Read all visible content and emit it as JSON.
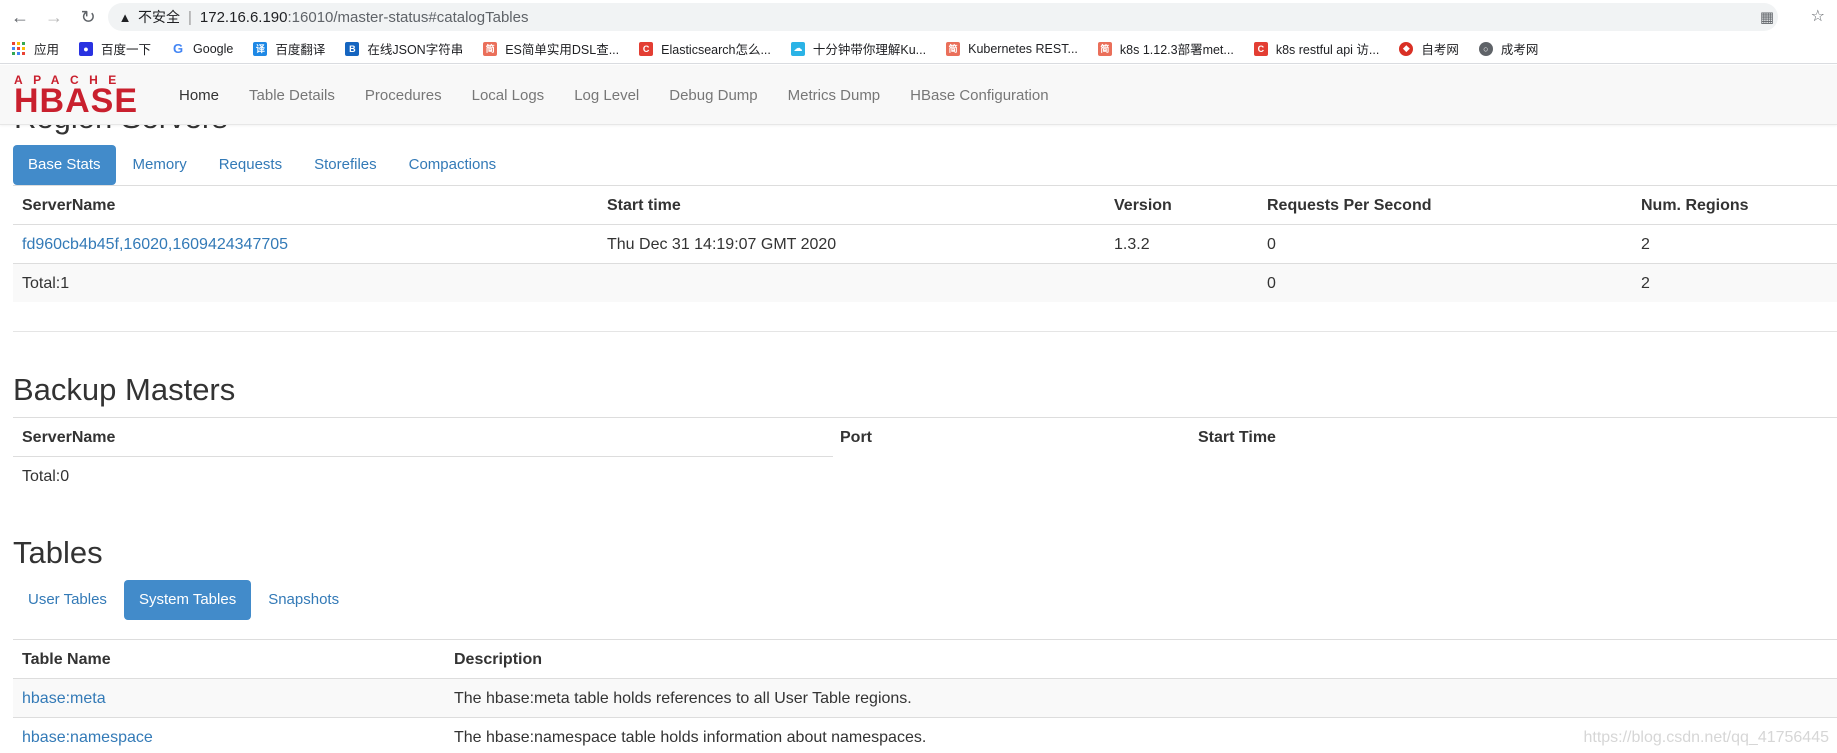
{
  "browser": {
    "insecure_label": "不安全",
    "url_host": "172.16.6.190",
    "url_rest": ":16010/master-status#catalogTables"
  },
  "bookmarks": [
    {
      "label": "应用",
      "icon": "apps-grid-icon",
      "color": "#4285f4"
    },
    {
      "label": "百度一下",
      "icon": "baidu-paw-icon",
      "color": "#2932e1"
    },
    {
      "label": "Google",
      "icon": "google-g-icon",
      "color": "#4285f4"
    },
    {
      "label": "百度翻译",
      "icon": "baidu-translate-icon",
      "color": "#1e88e5"
    },
    {
      "label": "在线JSON字符串",
      "icon": "json-icon",
      "color": "#1565c0"
    },
    {
      "label": "ES简单实用DSL查...",
      "icon": "jianshu-icon",
      "color": "#ea6f5a"
    },
    {
      "label": "Elasticsearch怎么...",
      "icon": "csdn-c-icon",
      "color": "#e33e33"
    },
    {
      "label": "十分钟带你理解Ku...",
      "icon": "cloud-icon",
      "color": "#2bb3e6"
    },
    {
      "label": "Kubernetes REST...",
      "icon": "jianshu-icon",
      "color": "#ea6f5a"
    },
    {
      "label": "k8s 1.12.3部署met...",
      "icon": "jianshu-icon",
      "color": "#ea6f5a"
    },
    {
      "label": "k8s restful api 访...",
      "icon": "csdn-c-icon",
      "color": "#e33e33"
    },
    {
      "label": "自考网",
      "icon": "zikao-icon",
      "color": "#d93025"
    },
    {
      "label": "成考网",
      "icon": "globe-icon",
      "color": "#5f6368"
    }
  ],
  "navbar": {
    "logo_top": "APACHE",
    "logo_main": "HBASE",
    "links": [
      "Home",
      "Table Details",
      "Procedures",
      "Local Logs",
      "Log Level",
      "Debug Dump",
      "Metrics Dump",
      "HBase Configuration"
    ]
  },
  "region_servers": {
    "heading": "Region Servers",
    "tabs": [
      "Base Stats",
      "Memory",
      "Requests",
      "Storefiles",
      "Compactions"
    ],
    "columns": [
      "ServerName",
      "Start time",
      "Version",
      "Requests Per Second",
      "Num. Regions"
    ],
    "rows": [
      {
        "server": "fd960cb4b45f,16020,1609424347705",
        "start": "Thu Dec 31 14:19:07 GMT 2020",
        "version": "1.3.2",
        "rps": "0",
        "regions": "2"
      }
    ],
    "total": {
      "label": "Total:1",
      "rps": "0",
      "regions": "2"
    }
  },
  "backup_masters": {
    "heading": "Backup Masters",
    "columns": [
      "ServerName",
      "Port",
      "Start Time"
    ],
    "total": "Total:0"
  },
  "tables": {
    "heading": "Tables",
    "tabs": [
      "User Tables",
      "System Tables",
      "Snapshots"
    ],
    "columns": [
      "Table Name",
      "Description"
    ],
    "rows": [
      {
        "name": "hbase:meta",
        "desc": "The hbase:meta table holds references to all User Table regions."
      },
      {
        "name": "hbase:namespace",
        "desc": "The hbase:namespace table holds information about namespaces."
      }
    ]
  },
  "watermark": "https://blog.csdn.net/qq_41756445",
  "colors": {
    "link": "#337ab7",
    "active_pill": "#428bca",
    "logo_red": "#c9202e"
  }
}
